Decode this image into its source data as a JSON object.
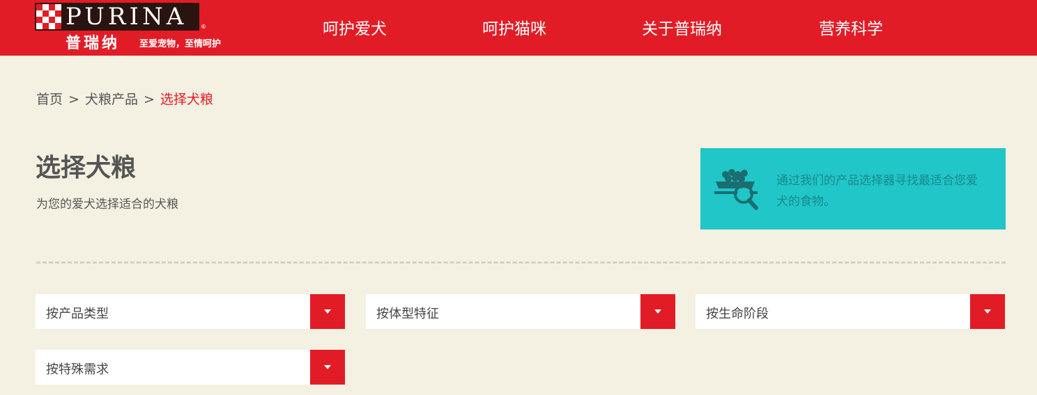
{
  "brand": {
    "logo_word": "PURINA",
    "logo_cn": "普瑞纳",
    "slogan": "至爱宠物，至情呵护",
    "registered_mark": "®",
    "colors": {
      "primary_red": "#e21c26",
      "logo_dark": "#2a1410",
      "page_bg": "#f4f0e2",
      "promo_teal": "#20c6c8"
    }
  },
  "nav": [
    {
      "label": "呵护爱犬"
    },
    {
      "label": "呵护猫咪"
    },
    {
      "label": "关于普瑞纳"
    },
    {
      "label": "营养科学"
    }
  ],
  "breadcrumb": {
    "items": [
      "首页",
      "犬粮产品",
      "选择犬粮"
    ],
    "separator": ">"
  },
  "page": {
    "title": "选择犬粮",
    "subtitle": "为您的爱犬选择适合的犬粮"
  },
  "promo": {
    "icon": "food-bowl-search-icon",
    "text": "通过我们的产品选择器寻找最适合您爱犬的食物。"
  },
  "filters": [
    {
      "label": "按产品类型",
      "icon": "dropdown-caret-icon"
    },
    {
      "label": "按体型特征",
      "icon": "dropdown-caret-icon"
    },
    {
      "label": "按生命阶段",
      "icon": "dropdown-caret-icon"
    },
    {
      "label": "按特殊需求",
      "icon": "dropdown-caret-icon"
    }
  ]
}
